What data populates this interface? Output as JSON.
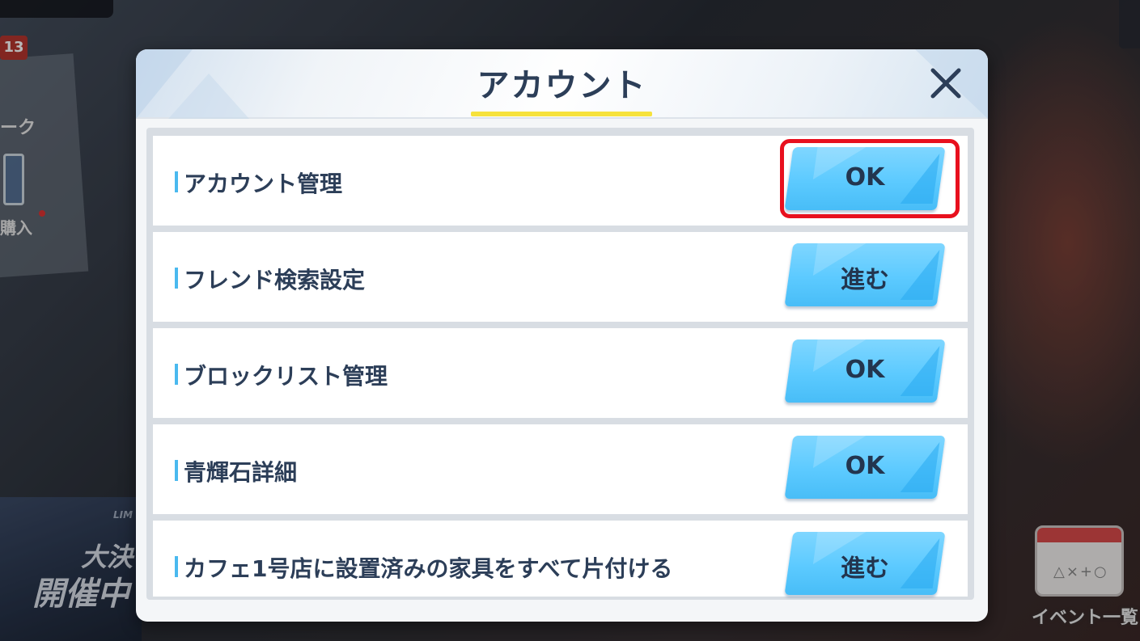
{
  "background": {
    "badge_number": "13",
    "side_label_1": "ーク",
    "side_label_2": "購入",
    "banner_small": "LIM",
    "banner_line1": "大決",
    "banner_line2": "開催中",
    "calendar_marks": "△×+○",
    "event_list_label": "イベント一覧"
  },
  "dialog": {
    "title": "アカウント",
    "rows": [
      {
        "label": "アカウント管理",
        "button": "OK"
      },
      {
        "label": "フレンド検索設定",
        "button": "進む"
      },
      {
        "label": "ブロックリスト管理",
        "button": "OK"
      },
      {
        "label": "青輝石詳細",
        "button": "OK"
      },
      {
        "label": "カフェ1号店に設置済みの家具をすべて片付ける",
        "button": "進む"
      }
    ]
  },
  "colors": {
    "title_underline": "#f6e23c",
    "button": "#5ccaff",
    "row_accent_bar": "#4ab9ef",
    "highlight": "#e8101e",
    "text": "#2c3e58"
  }
}
